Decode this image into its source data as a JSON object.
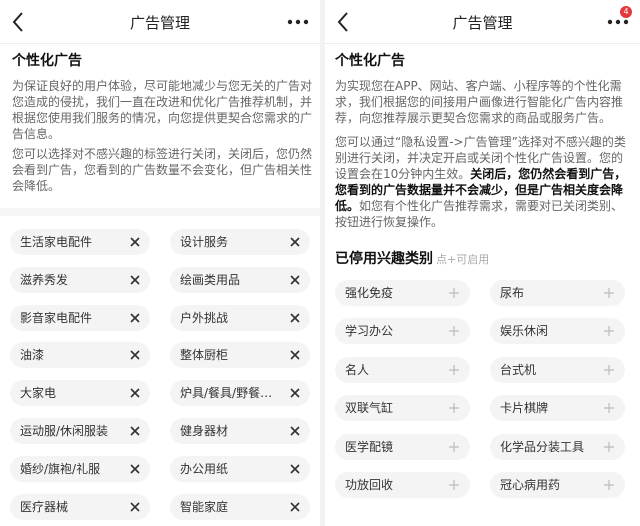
{
  "left": {
    "nav": {
      "title": "广告管理"
    },
    "section_title": "个性化广告",
    "paragraph1": "为保证良好的用户体验，尽可能地减少与您无关的广告对您造成的侵扰，我们一直在改进和优化广告推荐机制，并根据您使用我们服务的情况，向您提供更契合您需求的广告信息。",
    "paragraph2": "您可以选择对不感兴趣的标签进行关闭，关闭后，您仍然会看到广告，您看到的广告数量不会变化，但广告相关性会降低。",
    "tags": [
      "生活家电配件",
      "设计服务",
      "滋养秀发",
      "绘画类用品",
      "影音家电配件",
      "户外挑战",
      "油漆",
      "整体厨柜",
      "大家电",
      "炉具/餐具/野餐烧...",
      "运动服/休闲服装",
      "健身器材",
      "婚纱/旗袍/礼服",
      "办公用纸",
      "医疗器械",
      "智能家庭"
    ]
  },
  "right": {
    "nav": {
      "title": "广告管理",
      "badge": "4"
    },
    "section_title": "个性化广告",
    "paragraph1": "为实现您在APP、网站、客户端、小程序等的个性化需求，我们根据您的间接用户画像进行智能化广告内容推荐，向您推荐展示更契合您需求的商品或服务广告。",
    "paragraph2_a": "您可以通过“隐私设置->广告管理”选择对不感兴趣的类别进行关闭，并决定开启或关闭个性化广告设置。您的设置会在10分钟内生效。",
    "paragraph2_bold": "关闭后，您仍然会看到广告，您看到的广告数据量并不会减少，但是广告相关度会降低。",
    "paragraph2_c": "如您有个性化广告推荐需求，需要对已关闭类别、按钮进行恢复操作。",
    "disabled_title": "已停用兴趣类别",
    "disabled_hint": "点+可启用",
    "disabled_tags": [
      "强化免疫",
      "尿布",
      "学习办公",
      "娱乐休闲",
      "名人",
      "台式机",
      "双联气缸",
      "卡片棋牌",
      "医学配镜",
      "化学品分装工具",
      "功放回收",
      "冠心病用药"
    ]
  },
  "colors": {
    "chip_bg": "#f4f4f4",
    "badge": "#e4393c",
    "text_gray": "#666666"
  },
  "icons": {
    "back": "chevron-left-icon",
    "more": "more-dots-icon",
    "remove": "close-icon",
    "add": "plus-icon"
  }
}
